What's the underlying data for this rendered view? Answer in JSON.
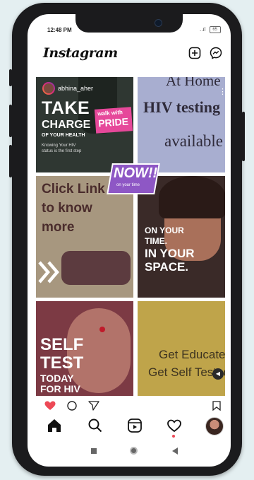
{
  "status": {
    "time": "12:48 PM",
    "signal": "..ıl",
    "battery": "65"
  },
  "app": {
    "title": "Instagram",
    "dropdown_icon": "chevron-down-icon",
    "new_post_icon": "plus-square-icon",
    "messenger_icon": "messenger-icon"
  },
  "posts": [
    {
      "username": "abhina_aher",
      "line1": "TAKE",
      "line2": "CHARGE",
      "line3": "OF YOUR HEALTH",
      "caption": "Knowing Your HIV",
      "caption2": "status is the first step",
      "badge1": "walk with",
      "badge2": "PRIDE"
    },
    {
      "line0": "At Home",
      "line1": "HIV testing",
      "line2": "available"
    },
    {
      "line1": "Click Link",
      "line2": "to know",
      "line3": "more"
    },
    {
      "line1": "ON YOUR",
      "line2": "TIME.",
      "line3": "IN YOUR",
      "line4": "SPACE."
    },
    {
      "line1": "SELF",
      "line2": "TEST",
      "line3": "TODAY",
      "line4": "FOR HIV"
    },
    {
      "line1": "Get Educated",
      "line2": "Get Self Tested"
    }
  ],
  "sticker": {
    "text": "NOW!!",
    "sub": "on your time"
  },
  "colors": {
    "accent_red": "#ed4956",
    "badge_pink": "#e6489a",
    "sticker_purple": "#8e57c5"
  },
  "nav": [
    "home-icon",
    "search-icon",
    "reels-icon",
    "heart-icon",
    "profile-avatar"
  ]
}
